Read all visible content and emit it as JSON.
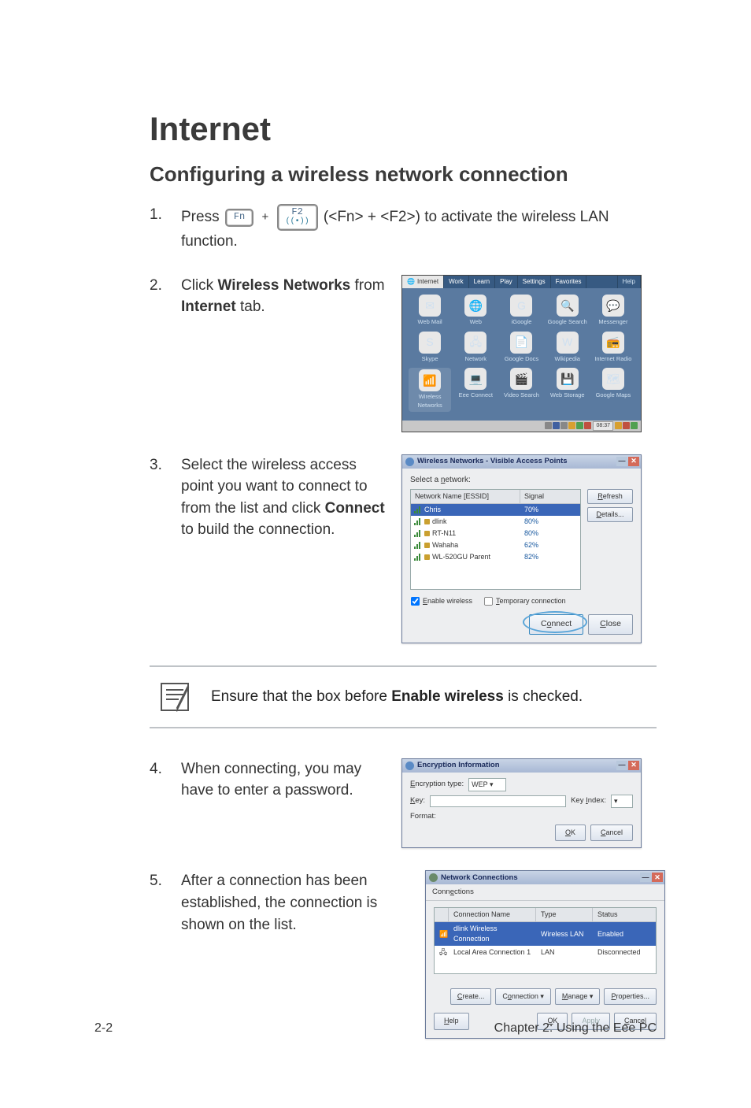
{
  "heading": "Internet",
  "subheading": "Configuring a wireless network connection",
  "step1": {
    "num": "1.",
    "pre": "Press ",
    "key1": "Fn",
    "key2_top": "F2",
    "key2_sym": "((•))",
    "post": " (<Fn> + <F2>) to activate the wireless LAN function."
  },
  "step2": {
    "num": "2.",
    "text_a": "Click ",
    "bold_a": "Wireless Networks",
    "text_b": " from ",
    "bold_b": "Internet",
    "text_c": " tab.",
    "tabs": [
      "Internet",
      "Work",
      "Learn",
      "Play",
      "Settings",
      "Favorites"
    ],
    "help": "Help",
    "apps": [
      {
        "label": "Web Mail",
        "glyph": "✉"
      },
      {
        "label": "Web",
        "glyph": "🌐"
      },
      {
        "label": "iGoogle",
        "glyph": "G"
      },
      {
        "label": "Google Search",
        "glyph": "🔍"
      },
      {
        "label": "Messenger",
        "glyph": "💬"
      },
      {
        "label": "Skype",
        "glyph": "S"
      },
      {
        "label": "Network",
        "glyph": "🖧"
      },
      {
        "label": "Google Docs",
        "glyph": "📄"
      },
      {
        "label": "Wikipedia",
        "glyph": "W"
      },
      {
        "label": "Internet Radio",
        "glyph": "📻"
      },
      {
        "label": "Wireless Networks",
        "glyph": "📶"
      },
      {
        "label": "Eee Connect",
        "glyph": "💻"
      },
      {
        "label": "Video Search",
        "glyph": "🎬"
      },
      {
        "label": "Web Storage",
        "glyph": "💾"
      },
      {
        "label": "Google Maps",
        "glyph": "🗺"
      }
    ],
    "clock": "08:37"
  },
  "step3": {
    "num": "3.",
    "text_a": "Select the wireless access point you want to connect to from the list and click ",
    "bold_a": "Connect",
    "text_b": " to build the connection.",
    "title": "Wireless Networks - Visible Access Points",
    "select_label": "Select a network:",
    "col_name": "Network Name [ESSID]",
    "col_sig": "Signal",
    "networks": [
      {
        "name": "Chris",
        "sig": "70%",
        "sel": true,
        "lock": false
      },
      {
        "name": "dlink",
        "sig": "80%",
        "lock": true
      },
      {
        "name": "RT-N11",
        "sig": "80%",
        "lock": true
      },
      {
        "name": "Wahaha",
        "sig": "62%",
        "lock": true
      },
      {
        "name": "WL-520GU Parent",
        "sig": "82%",
        "lock": true
      }
    ],
    "refresh": "Refresh",
    "details": "Details...",
    "enable": "Enable wireless",
    "temp": "Temporary connection",
    "connect": "Connect",
    "close": "Close"
  },
  "note": {
    "text_a": "Ensure that the box before ",
    "bold": "Enable wireless",
    "text_b": " is checked."
  },
  "step4": {
    "num": "4.",
    "text": "When connecting, you may have to enter a password.",
    "title": "Encryption Information",
    "enc_type_label": "Encryption type:",
    "enc_type_val": "WEP",
    "key_label": "Key:",
    "key_index": "Key Index:",
    "format": "Format:",
    "ok": "OK",
    "cancel": "Cancel"
  },
  "step5": {
    "num": "5.",
    "text": "After a connection has been established, the connection is shown on the list.",
    "title": "Network Connections",
    "menu": "Connections",
    "col_name": "Connection Name",
    "col_type": "Type",
    "col_status": "Status",
    "rows": [
      {
        "name": "dlink Wireless Connection",
        "type": "Wireless LAN",
        "status": "Enabled",
        "sel": true
      },
      {
        "name": "Local Area Connection 1",
        "type": "LAN",
        "status": "Disconnected"
      }
    ],
    "create": "Create...",
    "connection": "Connection",
    "manage": "Manage",
    "properties": "Properties...",
    "help": "Help",
    "ok": "OK",
    "apply": "Apply",
    "cancel": "Cancel"
  },
  "footer": {
    "left": "2-2",
    "right": "Chapter 2: Using the Eee PC"
  }
}
